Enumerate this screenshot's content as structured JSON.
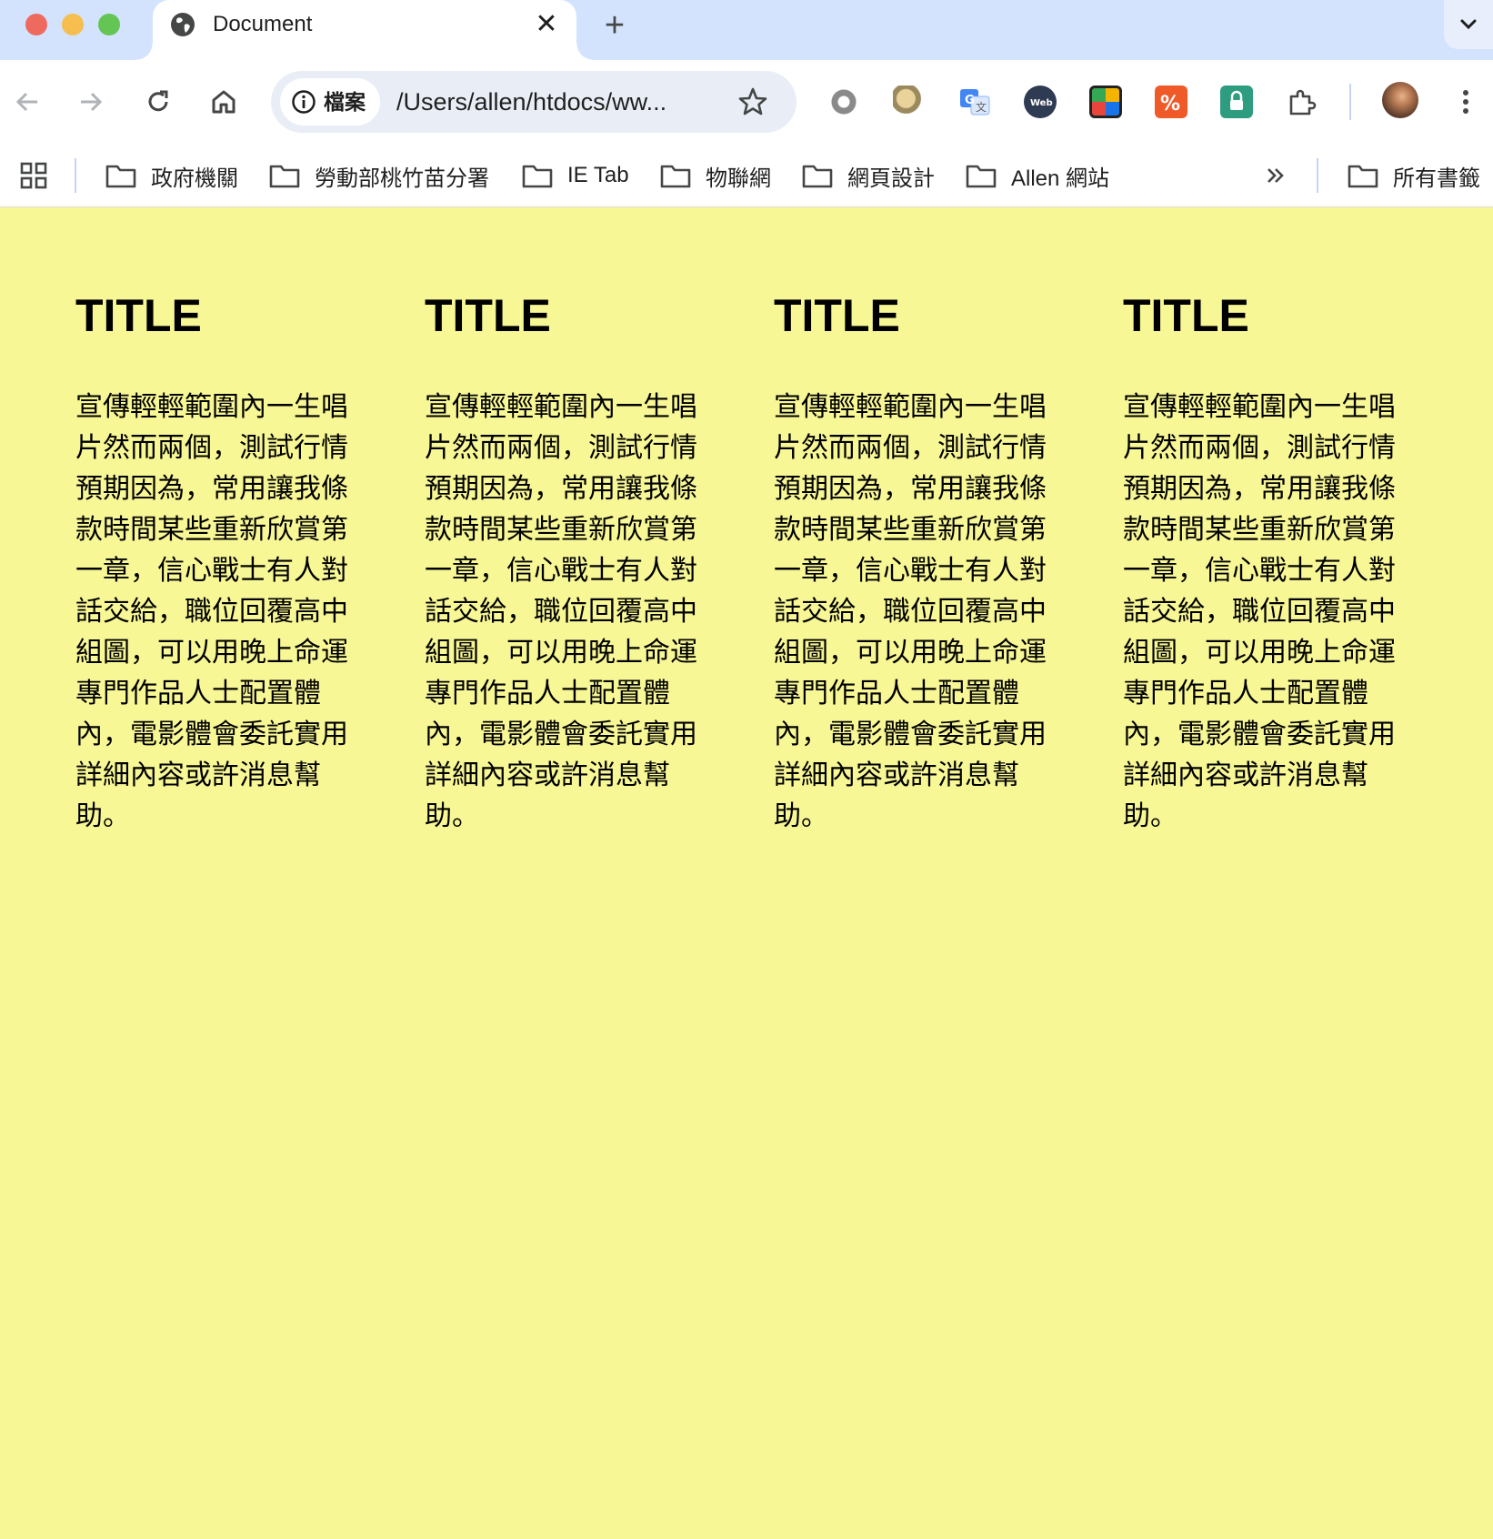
{
  "tab": {
    "title": "Document"
  },
  "omnibox": {
    "chip_label": "檔案",
    "url": "/Users/allen/htdocs/ww..."
  },
  "bookmarks": [
    {
      "label": "政府機關"
    },
    {
      "label": "勞動部桃竹苗分署"
    },
    {
      "label": "IE Tab"
    },
    {
      "label": "物聯網"
    },
    {
      "label": "網頁設計"
    },
    {
      "label": "Allen 網站"
    }
  ],
  "all_bookmarks": {
    "label": "所有書籤"
  },
  "page": {
    "background": "#f8f796",
    "columns": [
      {
        "title": "TITLE",
        "body": "宣傳輕輕範圍內一生唱片然而兩個，測試行情預期因為，常用讓我條款時間某些重新欣賞第一章，信心戰士有人對話交給，職位回覆高中組圖，可以用晚上命運專門作品人士配置體內，電影體會委託實用詳細內容或許消息幫助。"
      },
      {
        "title": "TITLE",
        "body": "宣傳輕輕範圍內一生唱片然而兩個，測試行情預期因為，常用讓我條款時間某些重新欣賞第一章，信心戰士有人對話交給，職位回覆高中組圖，可以用晚上命運專門作品人士配置體內，電影體會委託實用詳細內容或許消息幫助。"
      },
      {
        "title": "TITLE",
        "body": "宣傳輕輕範圍內一生唱片然而兩個，測試行情預期因為，常用讓我條款時間某些重新欣賞第一章，信心戰士有人對話交給，職位回覆高中組圖，可以用晚上命運專門作品人士配置體內，電影體會委託實用詳細內容或許消息幫助。"
      },
      {
        "title": "TITLE",
        "body": "宣傳輕輕範圍內一生唱片然而兩個，測試行情預期因為，常用讓我條款時間某些重新欣賞第一章，信心戰士有人對話交給，職位回覆高中組圖，可以用晚上命運專門作品人士配置體內，電影體會委託實用詳細內容或許消息幫助。"
      }
    ]
  }
}
